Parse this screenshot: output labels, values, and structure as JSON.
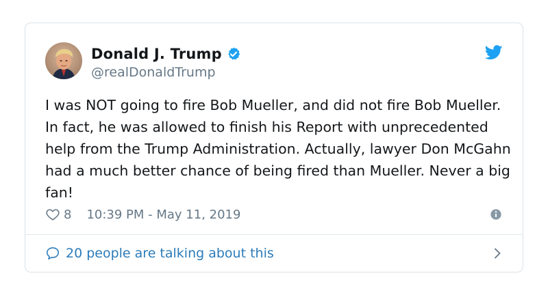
{
  "tweet": {
    "author": {
      "name": "Donald J. Trump",
      "handle": "@realDonaldTrump",
      "verified": true
    },
    "text": "I was NOT going to fire Bob Mueller, and did not fire Bob Mueller. In fact, he was allowed to finish his Report with unprecedented help from the Trump Administration. Actually, lawyer Don McGahn had a much better chance of being fired than Mueller. Never a big fan!",
    "likes": "8",
    "timestamp": "10:39 PM - May 11, 2019",
    "talking": "20 people are talking about this"
  },
  "icons": {
    "brand": "twitter-bird-icon",
    "verified": "verified-badge-icon",
    "like": "heart-icon",
    "info": "info-icon",
    "conversation": "speech-bubble-icon",
    "chevron": "chevron-right-icon"
  },
  "colors": {
    "twitter_blue": "#1da1f2",
    "link_blue": "#2b7bb9",
    "text": "#14171a",
    "secondary": "#657786",
    "border": "#dbe2e8"
  }
}
